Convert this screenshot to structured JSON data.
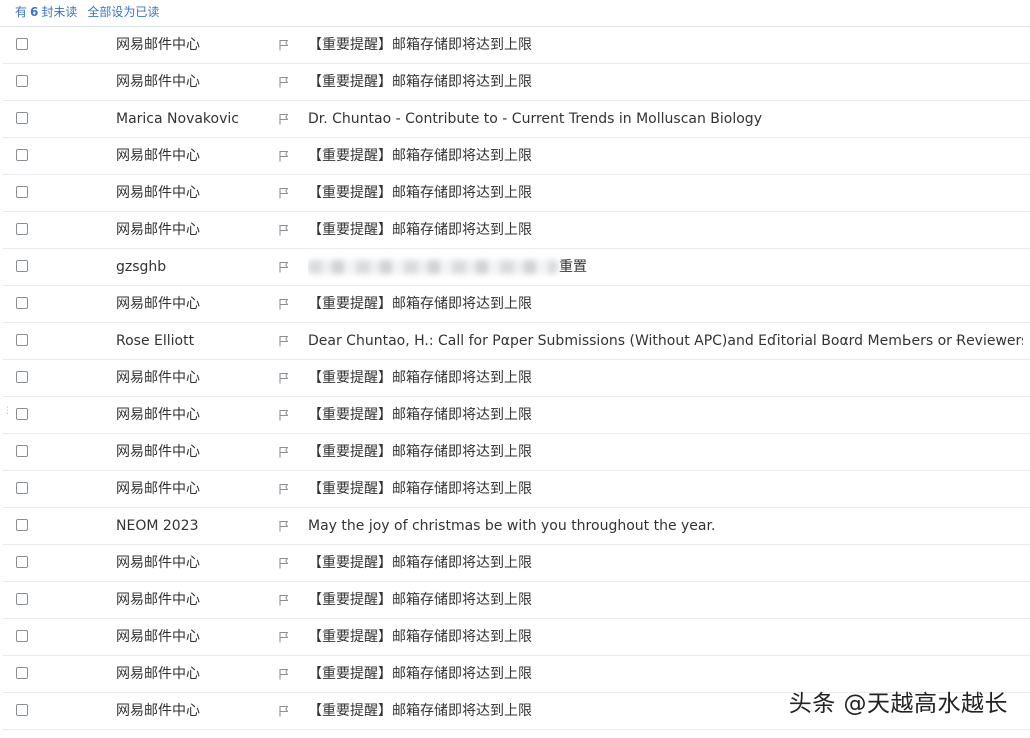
{
  "topbar": {
    "prefix": "有",
    "unread_count": "6",
    "suffix": "封未读",
    "mark_all_read": "全部设为已读"
  },
  "emails": [
    {
      "sender": "网易邮件中心",
      "subject": "【重要提醒】邮箱存储即将达到上限"
    },
    {
      "sender": "网易邮件中心",
      "subject": "【重要提醒】邮箱存储即将达到上限"
    },
    {
      "sender": "Marica Novakovic",
      "subject": "Dr. Chuntao - Contribute to - Current Trends in Molluscan Biology"
    },
    {
      "sender": "网易邮件中心",
      "subject": "【重要提醒】邮箱存储即将达到上限"
    },
    {
      "sender": "网易邮件中心",
      "subject": "【重要提醒】邮箱存储即将达到上限"
    },
    {
      "sender": "网易邮件中心",
      "subject": "【重要提醒】邮箱存储即将达到上限"
    },
    {
      "sender": "gzsghb",
      "subject": "重置",
      "blurred_prefix": true
    },
    {
      "sender": "网易邮件中心",
      "subject": "【重要提醒】邮箱存储即将达到上限"
    },
    {
      "sender": "Rose Elliott",
      "subject": "Dear Chuntao, H.: Call for Pαper Submissions (Without AΡC)and Eɗitorial Boαrd MеmЬеrs or Ɍeviewers"
    },
    {
      "sender": "网易邮件中心",
      "subject": "【重要提醒】邮箱存储即将达到上限"
    },
    {
      "sender": "网易邮件中心",
      "subject": "【重要提醒】邮箱存储即将达到上限"
    },
    {
      "sender": "网易邮件中心",
      "subject": "【重要提醒】邮箱存储即将达到上限"
    },
    {
      "sender": "网易邮件中心",
      "subject": "【重要提醒】邮箱存储即将达到上限"
    },
    {
      "sender": "NEOM 2023",
      "subject": "May the joy of christmas be with you throughout the year."
    },
    {
      "sender": "网易邮件中心",
      "subject": "【重要提醒】邮箱存储即将达到上限"
    },
    {
      "sender": "网易邮件中心",
      "subject": "【重要提醒】邮箱存储即将达到上限"
    },
    {
      "sender": "网易邮件中心",
      "subject": "【重要提醒】邮箱存储即将达到上限"
    },
    {
      "sender": "网易邮件中心",
      "subject": "【重要提醒】邮箱存储即将达到上限"
    },
    {
      "sender": "网易邮件中心",
      "subject": "【重要提醒】邮箱存储即将达到上限"
    }
  ],
  "watermark": "头条 @天越高水越长"
}
